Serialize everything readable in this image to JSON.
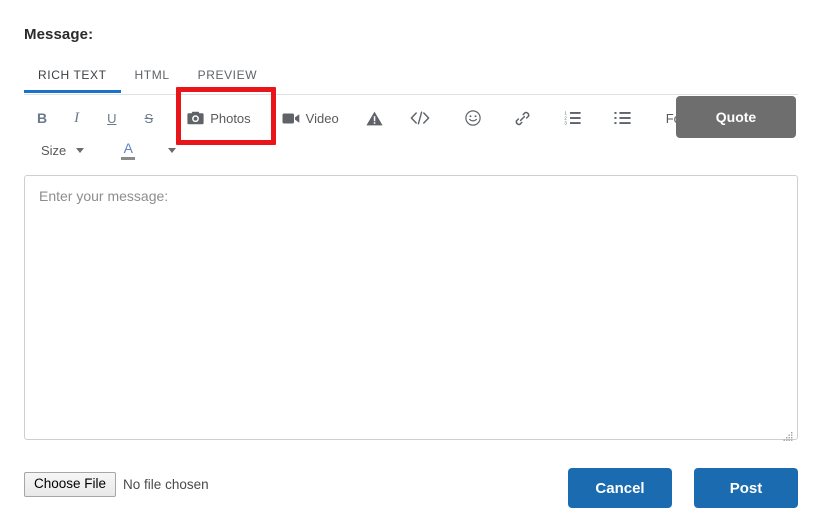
{
  "section": {
    "label": "Message:"
  },
  "tabs": [
    {
      "label": "Rich Text",
      "active": true
    },
    {
      "label": "HTML",
      "active": false
    },
    {
      "label": "Preview",
      "active": false
    }
  ],
  "toolbar": {
    "row1": [
      {
        "name": "bold-button",
        "glyph": "B",
        "label": ""
      },
      {
        "name": "italic-button",
        "glyph": "I",
        "label": ""
      },
      {
        "name": "underline-button",
        "glyph": "U",
        "label": ""
      },
      {
        "name": "strikethrough-button",
        "glyph": "S",
        "label": ""
      },
      {
        "name": "photos-button",
        "icon": "camera-icon",
        "label": "Photos"
      },
      {
        "name": "video-button",
        "icon": "video-camera-icon",
        "label": "Video"
      },
      {
        "name": "spoiler-button",
        "icon": "warning-triangle-icon",
        "label": ""
      },
      {
        "name": "code-button",
        "icon": "code-brackets-icon",
        "label": ""
      },
      {
        "name": "emoji-button",
        "icon": "smiley-face-icon",
        "label": ""
      },
      {
        "name": "link-button",
        "icon": "chain-link-icon",
        "label": ""
      },
      {
        "name": "ordered-list-button",
        "icon": "numbered-list-icon",
        "label": ""
      },
      {
        "name": "bullet-list-button",
        "icon": "bullet-list-icon",
        "label": ""
      },
      {
        "name": "font-dropdown",
        "icon": "chevron-down-icon",
        "label": "Font"
      }
    ],
    "quote_label": "Quote",
    "size_label": "Size",
    "font_label": "Font",
    "font_color_glyph": "A"
  },
  "editor": {
    "placeholder": "Enter your message:",
    "value": ""
  },
  "footer": {
    "choose_file_label": "Choose File",
    "no_file_label": "No file chosen",
    "cancel_label": "Cancel",
    "post_label": "Post"
  },
  "colors": {
    "tab_active_underline": "#1a73c8",
    "highlight_box": "#e8161a",
    "quote_button": "#6e6e6e",
    "primary_button": "#1a6bb0",
    "icon_gray": "#5f6368"
  }
}
